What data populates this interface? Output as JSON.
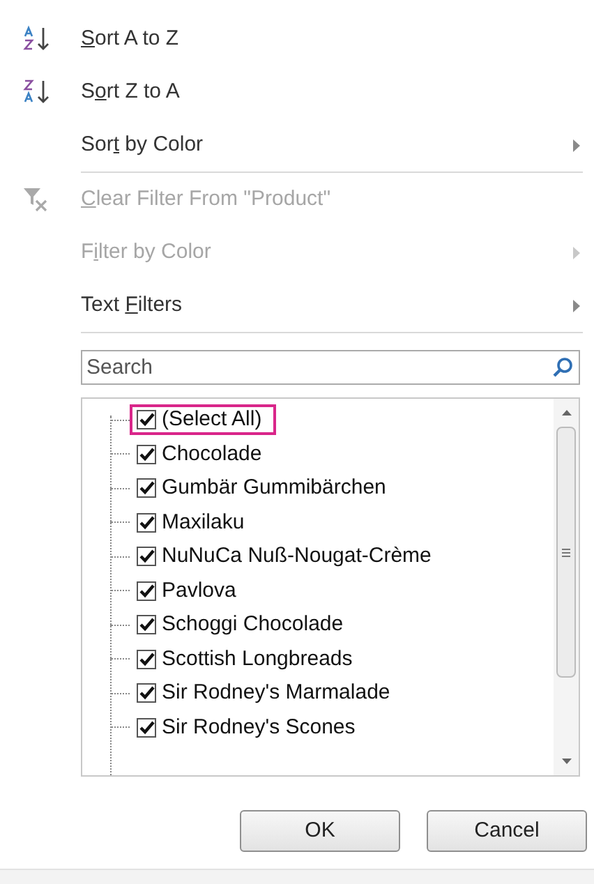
{
  "menu_groups": [
    [
      {
        "kind": "sort_az",
        "label": {
          "key": "S",
          "after": "ort A to Z"
        },
        "disabled": false,
        "submenu": false
      },
      {
        "kind": "sort_za",
        "label": {
          "before": "S",
          "key": "o",
          "after": "rt Z to A"
        },
        "disabled": false,
        "submenu": false
      },
      {
        "kind": "plain",
        "label": {
          "before": "Sor",
          "key": "t",
          "after": " by Color"
        },
        "disabled": false,
        "submenu": true
      }
    ],
    [
      {
        "kind": "clear_filter",
        "label": {
          "key": "C",
          "after": "lear Filter From \"Product\""
        },
        "disabled": true,
        "submenu": false
      },
      {
        "kind": "plain",
        "label": {
          "before": "F",
          "key": "i",
          "after": "lter by Color"
        },
        "disabled": true,
        "submenu": true
      },
      {
        "kind": "plain",
        "label": {
          "before": "Text ",
          "key": "F",
          "after": "ilters"
        },
        "disabled": false,
        "submenu": true
      }
    ]
  ],
  "search": {
    "placeholder": "Search"
  },
  "values": [
    {
      "label": "(Select All)",
      "checked": true,
      "highlighted": true
    },
    {
      "label": "Chocolade",
      "checked": true,
      "highlighted": false
    },
    {
      "label": "Gumbär Gummibärchen",
      "checked": true,
      "highlighted": false
    },
    {
      "label": "Maxilaku",
      "checked": true,
      "highlighted": false
    },
    {
      "label": "NuNuCa Nuß-Nougat-Crème",
      "checked": true,
      "highlighted": false
    },
    {
      "label": "Pavlova",
      "checked": true,
      "highlighted": false
    },
    {
      "label": "Schoggi Chocolade",
      "checked": true,
      "highlighted": false
    },
    {
      "label": "Scottish Longbreads",
      "checked": true,
      "highlighted": false
    },
    {
      "label": "Sir Rodney's Marmalade",
      "checked": true,
      "highlighted": false
    },
    {
      "label": "Sir Rodney's Scones",
      "checked": true,
      "highlighted": false
    }
  ],
  "buttons": [
    "OK",
    "Cancel"
  ]
}
